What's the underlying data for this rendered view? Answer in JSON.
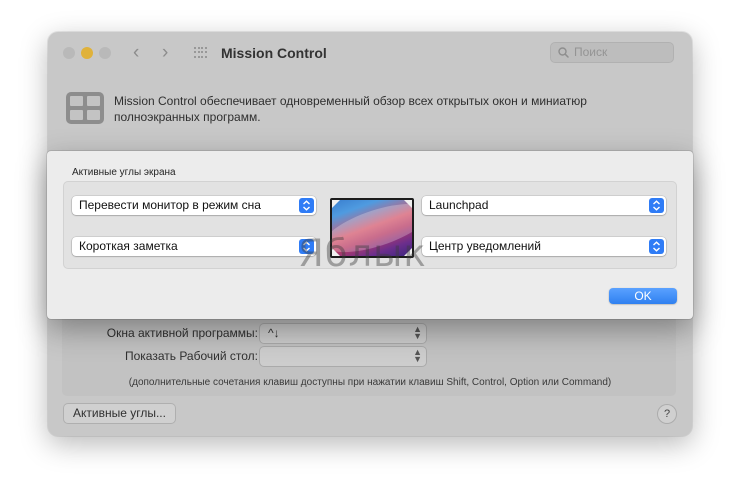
{
  "window": {
    "title": "Mission Control",
    "search_placeholder": "Поиск",
    "description": "Mission Control обеспечивает одновременный обзор всех открытых окон и миниатюр полноэкранных программ."
  },
  "lower_settings": {
    "rows": [
      {
        "label": "Окна активной программы:",
        "value": "^↓"
      },
      {
        "label": "Показать Рабочий стол:",
        "value": ""
      }
    ],
    "hint": "(дополнительные сочетания клавиш доступны при нажатии клавиш Shift, Control, Option или Command)",
    "hot_corners_button": "Активные углы...",
    "help_button": "?"
  },
  "sheet": {
    "group_title": "Активные углы экрана",
    "corners": {
      "top_left": "Перевести монитор в режим сна",
      "top_right": "Launchpad",
      "bottom_left": "Короткая заметка",
      "bottom_right": "Центр уведомлений"
    },
    "ok_label": "OK"
  },
  "watermark": "Яблык",
  "colors": {
    "accent": "#2f7cf6",
    "minimize_light": "#e0b23b"
  }
}
